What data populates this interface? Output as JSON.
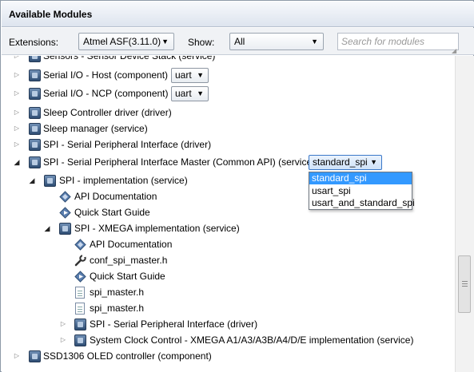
{
  "window": {
    "title": "Available Modules"
  },
  "filters": {
    "extensions_label": "Extensions:",
    "extensions_value": "Atmel ASF(3.11.0)",
    "show_label": "Show:",
    "show_value": "All",
    "search_placeholder": "Search for modules"
  },
  "tree": {
    "rows": [
      {
        "label": "Sensors - Sensor Device Stack (service)",
        "icon": "module-icon",
        "expander": "collapsed"
      },
      {
        "label": "Serial I/O - Host (component)",
        "icon": "module-icon",
        "expander": "collapsed",
        "select": "uart"
      },
      {
        "label": "Serial I/O - NCP (component)",
        "icon": "module-icon",
        "expander": "collapsed",
        "select": "uart"
      },
      {
        "label": "Sleep Controller driver (driver)",
        "icon": "module-icon",
        "expander": "collapsed"
      },
      {
        "label": "Sleep manager (service)",
        "icon": "module-icon",
        "expander": "collapsed"
      },
      {
        "label": "SPI - Serial Peripheral Interface (driver)",
        "icon": "module-icon",
        "expander": "collapsed"
      },
      {
        "label": "SPI - Serial Peripheral Interface Master (Common API) (service)",
        "icon": "module-icon",
        "expander": "expanded",
        "select": "standard_spi"
      },
      {
        "label": "SPI - implementation (service)",
        "icon": "module-icon",
        "expander": "expanded"
      },
      {
        "label": "API Documentation",
        "icon": "documentation-icon"
      },
      {
        "label": "Quick Start Guide",
        "icon": "quick-start-icon"
      },
      {
        "label": "SPI - XMEGA implementation (service)",
        "icon": "module-icon",
        "expander": "expanded"
      },
      {
        "label": "API Documentation",
        "icon": "documentation-icon"
      },
      {
        "label": "conf_spi_master.h",
        "icon": "wrench-icon"
      },
      {
        "label": "Quick Start Guide",
        "icon": "quick-start-icon"
      },
      {
        "label": "spi_master.h",
        "icon": "header-file-icon"
      },
      {
        "label": "spi_master.h",
        "icon": "header-file-icon"
      },
      {
        "label": "SPI - Serial Peripheral Interface (driver)",
        "icon": "module-icon",
        "expander": "collapsed"
      },
      {
        "label": "System Clock Control - XMEGA A1/A3/A3B/A4/D/E implementation (service)",
        "icon": "module-icon",
        "expander": "collapsed"
      },
      {
        "label": "SSD1306 OLED controller (component)",
        "icon": "module-icon",
        "expander": "collapsed"
      }
    ]
  },
  "dropdown": {
    "options": [
      "standard_spi",
      "usart_spi",
      "usart_and_standard_spi"
    ],
    "selected": "standard_spi"
  },
  "colors": {
    "selection": "#3399ff",
    "title_bar": "#dde4ee",
    "module_icon": "#2f4e74"
  }
}
